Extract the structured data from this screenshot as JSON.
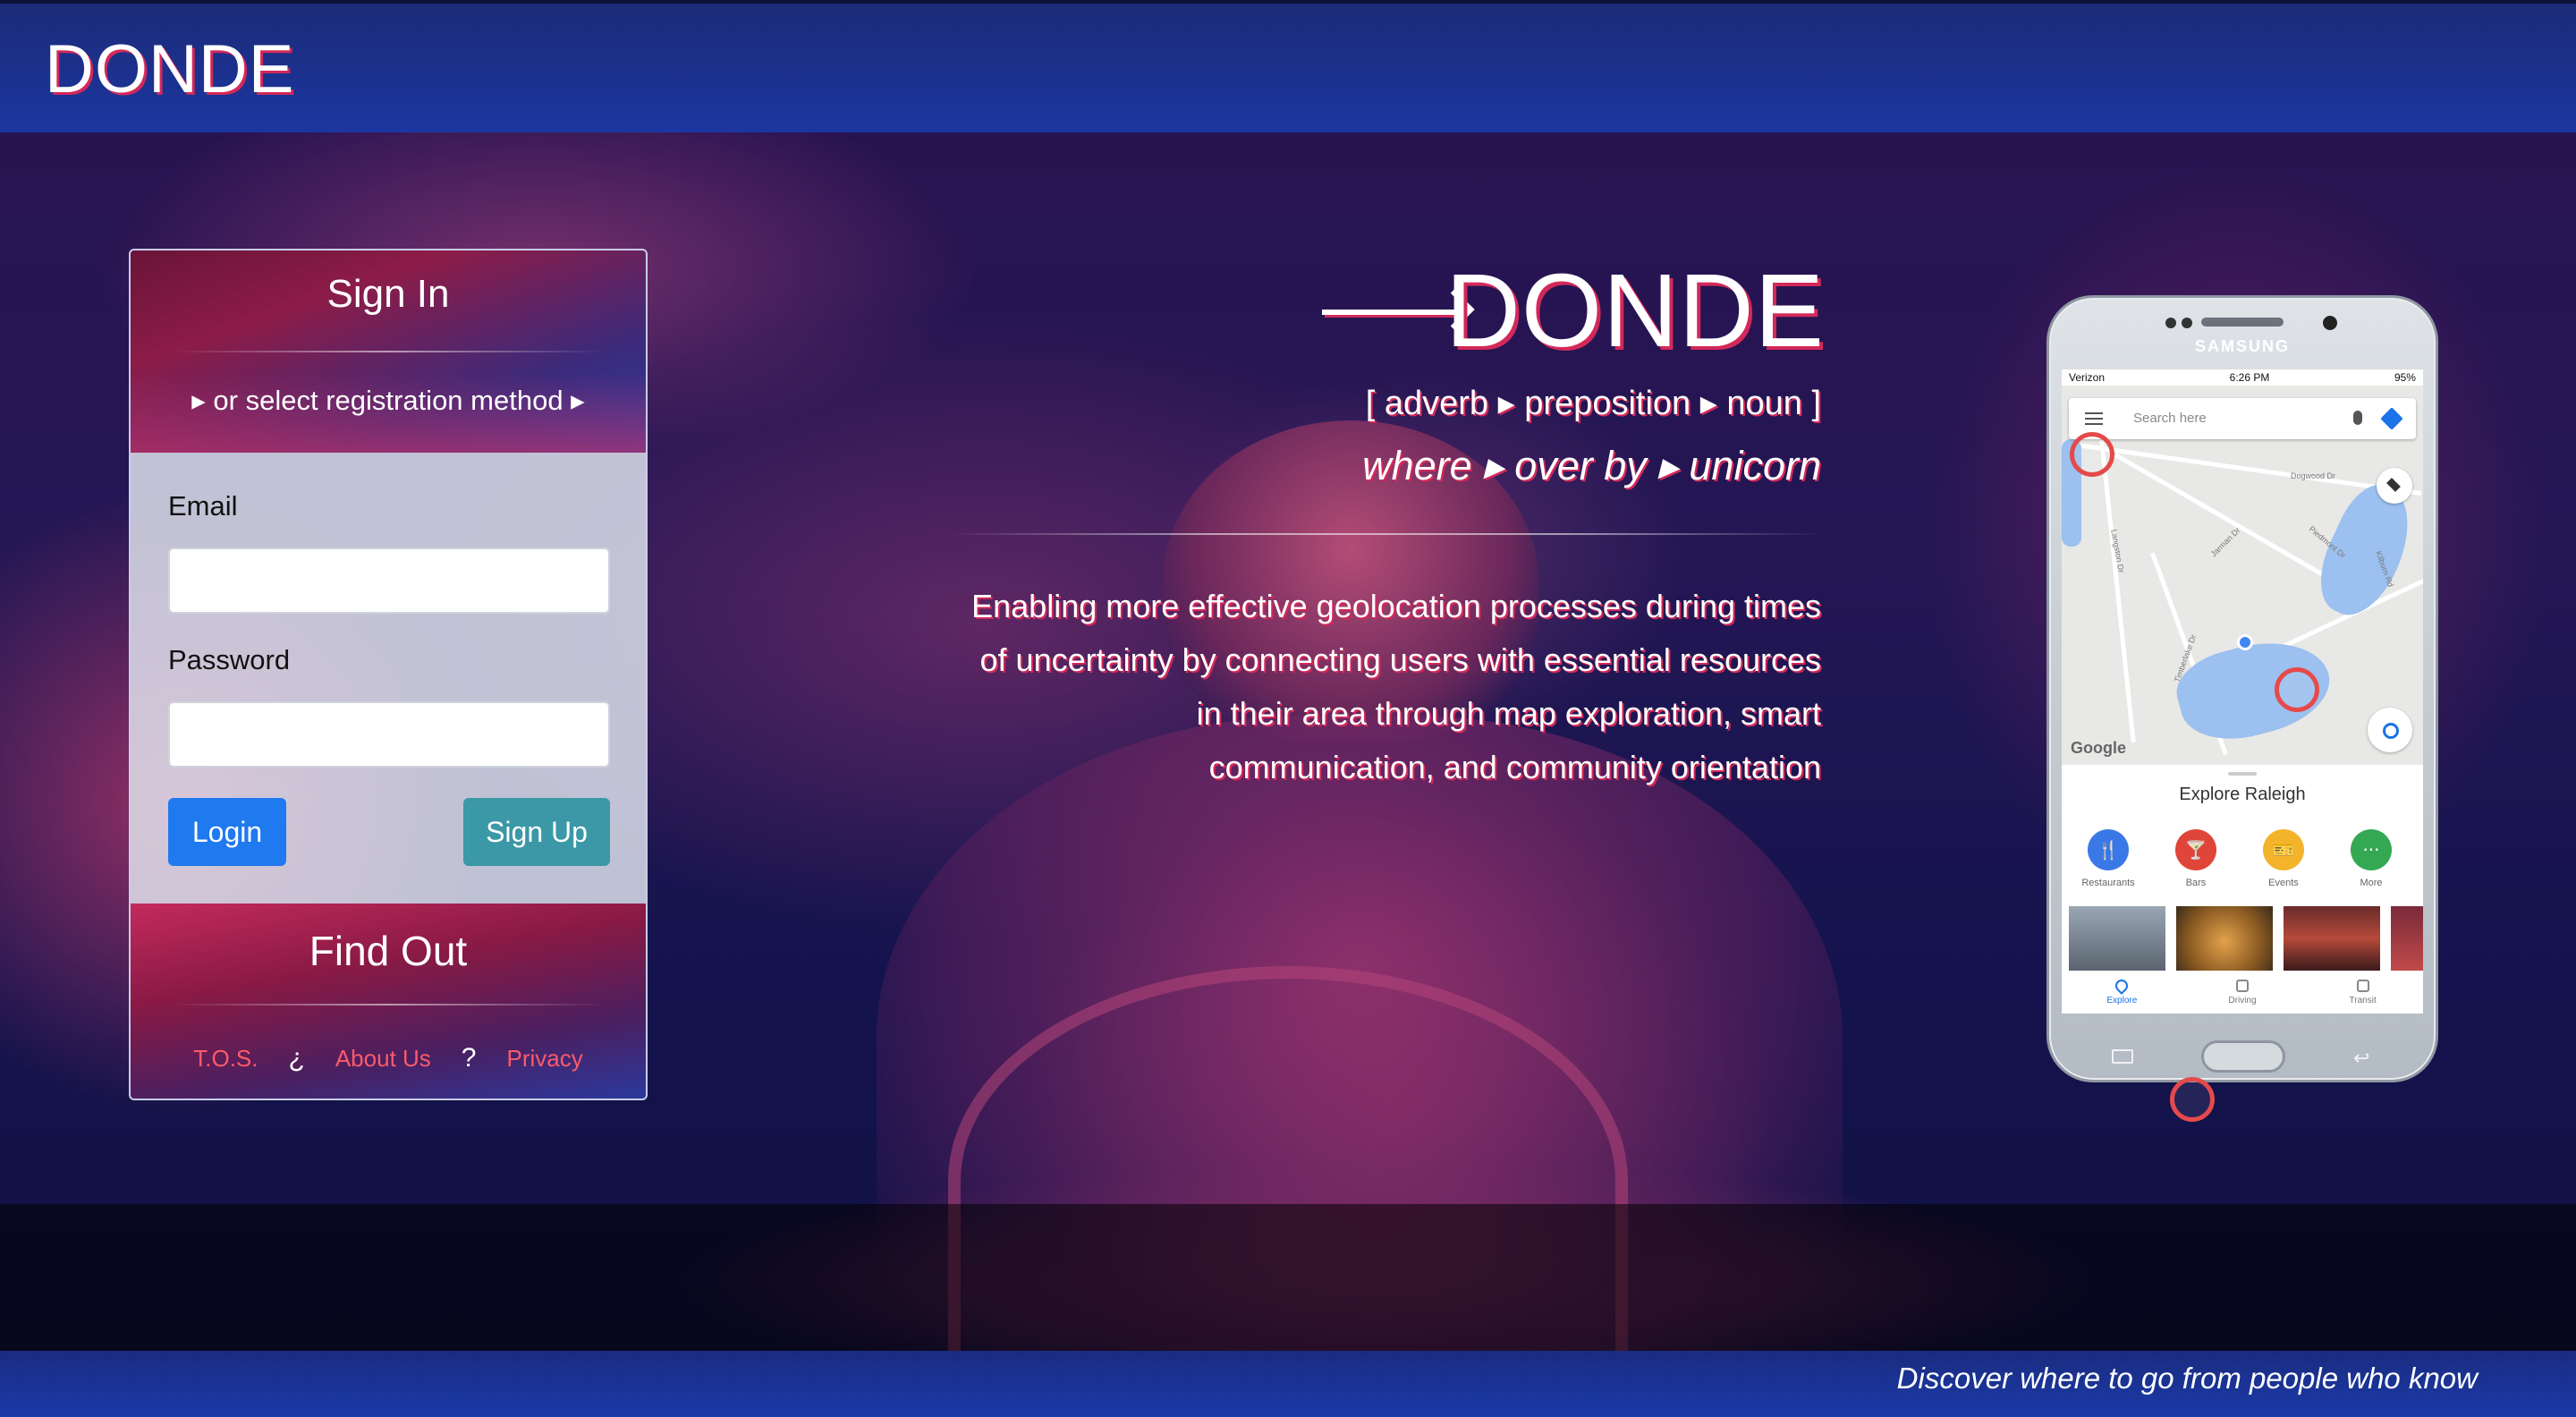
{
  "header": {
    "logo": "DONDE"
  },
  "signin": {
    "title": "Sign In",
    "subtitle": "▸ or select registration method ▸",
    "email_label": "Email",
    "email_value": "",
    "password_label": "Password",
    "password_value": "",
    "login_label": "Login",
    "signup_label": "Sign Up"
  },
  "find_out": {
    "title": "Find Out",
    "links": {
      "tos": "T.O.S.",
      "sep1": "¿",
      "about": "About Us",
      "sep2": "?",
      "privacy": "Privacy"
    }
  },
  "hero": {
    "title": "DONDE",
    "parts_of_speech": "[ adverb ▸ preposition ▸ noun ]",
    "definition": "where ▸ over by ▸ unicorn",
    "description_lines": [
      "Enabling more effective geolocation processes during times",
      "of uncertainty by connecting users with essential resources",
      "in their area through map exploration, smart",
      "communication, and community orientation"
    ]
  },
  "phone": {
    "brand": "SAMSUNG",
    "status": {
      "carrier": "Verizon",
      "time": "6:26 PM",
      "battery": "95%"
    },
    "search_placeholder": "Search here",
    "map_credit": "Google",
    "streets": [
      "Dogwood Dr",
      "Piedmont Dr",
      "Jarman Dr",
      "Langston Dr",
      "Timberlake Dr",
      "Kilburn Rd"
    ],
    "sheet_title": "Explore Raleigh",
    "categories": [
      {
        "label": "Restaurants",
        "color": "#3b78e7",
        "icon": "fork-knife-icon",
        "glyph": "🍴"
      },
      {
        "label": "Bars",
        "color": "#e0453a",
        "icon": "cocktail-icon",
        "glyph": "🍸"
      },
      {
        "label": "Events",
        "color": "#f3b32a",
        "icon": "ticket-icon",
        "glyph": "🎫"
      },
      {
        "label": "More",
        "color": "#34a853",
        "icon": "more-icon",
        "glyph": "···"
      }
    ],
    "nav": [
      "Explore",
      "Driving",
      "Transit"
    ]
  },
  "footer": {
    "tagline": "Discover where to go from people who know"
  },
  "colors": {
    "accent_pink": "#d3285a",
    "header_blue": "#1b36a0",
    "login_blue": "#1f79ef",
    "signup_teal": "#3b98a6",
    "link_red": "#ff5a68"
  }
}
